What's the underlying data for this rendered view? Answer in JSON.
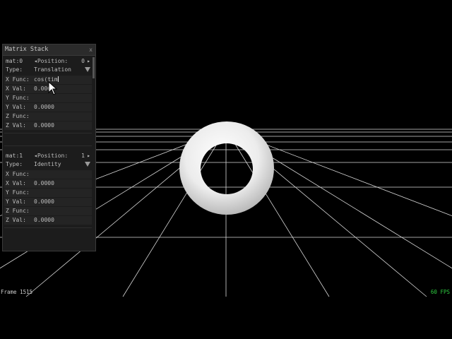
{
  "panel": {
    "title": "Matrix Stack",
    "close_label": "x",
    "matrices": [
      {
        "id": "mat:0",
        "position_label": "Position:",
        "position_value": "0",
        "type_label": "Type:",
        "type_value": "Translation",
        "x_func_label": "X Func:",
        "x_func_value": "cos(tim",
        "x_val_label": "X Val:",
        "x_val_value": "0.0000",
        "y_func_label": "Y Func:",
        "y_func_value": "",
        "y_val_label": "Y Val:",
        "y_val_value": "0.0000",
        "z_func_label": "Z Func:",
        "z_func_value": "",
        "z_val_label": "Z Val:",
        "z_val_value": "0.0000"
      },
      {
        "id": "mat:1",
        "position_label": "Position:",
        "position_value": "1",
        "type_label": "Type:",
        "type_value": "Identity",
        "x_func_label": "X Func:",
        "x_func_value": "",
        "x_val_label": "X Val:",
        "x_val_value": "0.0000",
        "y_func_label": "Y Func:",
        "y_func_value": "",
        "y_val_label": "Y Val:",
        "y_val_value": "0.0000",
        "z_func_label": "Z Func:",
        "z_func_value": "",
        "z_val_label": "Z Val:",
        "z_val_value": "0.0000"
      }
    ]
  },
  "status": {
    "frame": "Frame 1515",
    "fps": "60 FPS"
  },
  "colors": {
    "background": "#000000",
    "grid": "#d8d8d8",
    "fps_text": "#2ecc40",
    "torus": "#f0f0f0"
  },
  "icons": {
    "close": "close-icon",
    "left_arrow": "left-arrow-icon",
    "right_arrow": "right-arrow-icon",
    "dropdown": "chevron-down-icon",
    "cursor": "mouse-pointer-icon"
  }
}
